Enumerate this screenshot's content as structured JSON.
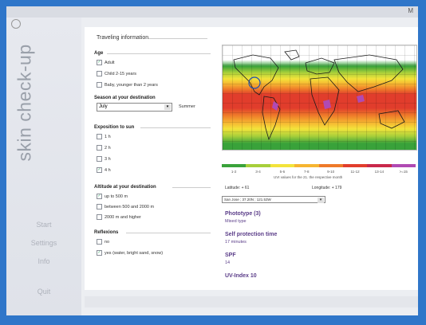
{
  "topbar": {
    "letter": "M"
  },
  "sidebar": {
    "brand": "skin check-up",
    "nav": [
      {
        "label": "Start"
      },
      {
        "label": "Settings"
      },
      {
        "label": "Info"
      },
      {
        "label": "Quit"
      }
    ]
  },
  "form": {
    "title": "Traveling information",
    "age": {
      "heading": "Age",
      "options": [
        {
          "label": "Adult",
          "checked": true
        },
        {
          "label": "Child 2-15 years",
          "checked": false
        },
        {
          "label": "Baby, younger than 2 years",
          "checked": false
        }
      ]
    },
    "season": {
      "heading": "Season at your destination",
      "selected": "July",
      "season_text": "Summer"
    },
    "exposition": {
      "heading": "Exposition to sun",
      "options": [
        {
          "label": "1 h",
          "checked": false
        },
        {
          "label": "2 h",
          "checked": false
        },
        {
          "label": "3 h",
          "checked": false
        },
        {
          "label": "4 h",
          "checked": true
        }
      ]
    },
    "altitude": {
      "heading": "Altitude at your destination",
      "options": [
        {
          "label": "up to 500 m",
          "checked": true
        },
        {
          "label": "between 500 and 2000 m",
          "checked": false
        },
        {
          "label": "2000 m and higher",
          "checked": false
        }
      ]
    },
    "reflexions": {
      "heading": "Reflexions",
      "options": [
        {
          "label": "no",
          "checked": false
        },
        {
          "label": "yes (water, bright sand, snow)",
          "checked": true
        }
      ]
    }
  },
  "map": {
    "legend": [
      "1-2",
      "3-4",
      "5-6",
      "7-8",
      "9-10",
      "11-12",
      "13-14",
      ">=15"
    ],
    "legend_colors": [
      "#39a23a",
      "#a7cf3a",
      "#f3e33b",
      "#f6b531",
      "#ee7a2a",
      "#e13d2c",
      "#c9284a",
      "#b04ab3"
    ],
    "caption": "UVI values for the 21. the respective month",
    "latitude": "Latitude: + 61",
    "longitude": "Longitude: + 179",
    "location": "San Jose ; 37.20N ; 121.53W"
  },
  "results": {
    "phototype_title": "Phototype (3)",
    "phototype_value": "Mixed type",
    "self_protection_title": "Self protection time",
    "self_protection_value": "17 minutes",
    "spf_title": "SPF",
    "spf_value": "14",
    "uv_index": "UV-Index 10"
  }
}
